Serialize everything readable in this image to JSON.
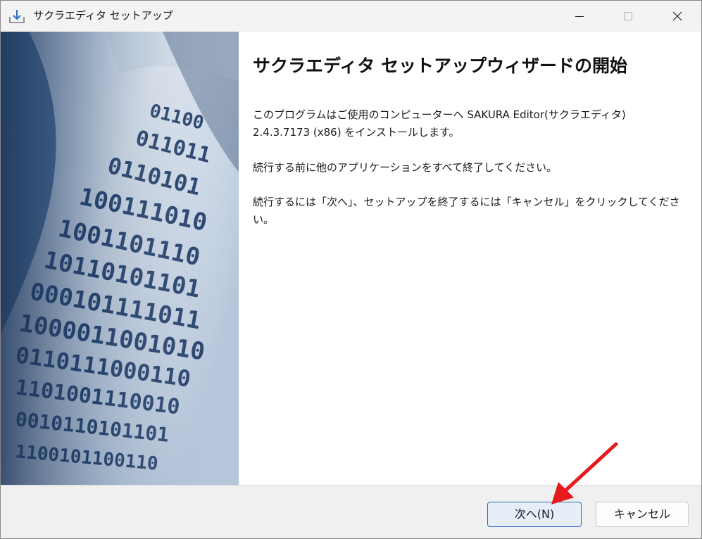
{
  "window": {
    "title": "サクラエディタ セットアップ",
    "icon": "installer-icon"
  },
  "controls": {
    "minimize_icon": "minimize-icon",
    "maximize_icon": "maximize-icon",
    "close_icon": "close-icon"
  },
  "content": {
    "heading": "サクラエディタ セットアップウィザードの開始",
    "paragraph1_line1": "このプログラムはご使用のコンピューターへ SAKURA Editor(サクラエディタ)",
    "paragraph1_line2": "2.4.3.7173 (x86) をインストールします。",
    "paragraph2": "続行する前に他のアプリケーションをすべて終了してください。",
    "paragraph3_line1": "続行するには「次へ」、セットアップを終了するには「キャンセル」をクリックしてくださ",
    "paragraph3_line2": "い。"
  },
  "buttons": {
    "next_label": "次へ(N)",
    "cancel_label": "キャンセル"
  },
  "colors": {
    "accent_border": "#2f6bc0",
    "annotation_arrow": "#e8191c"
  }
}
